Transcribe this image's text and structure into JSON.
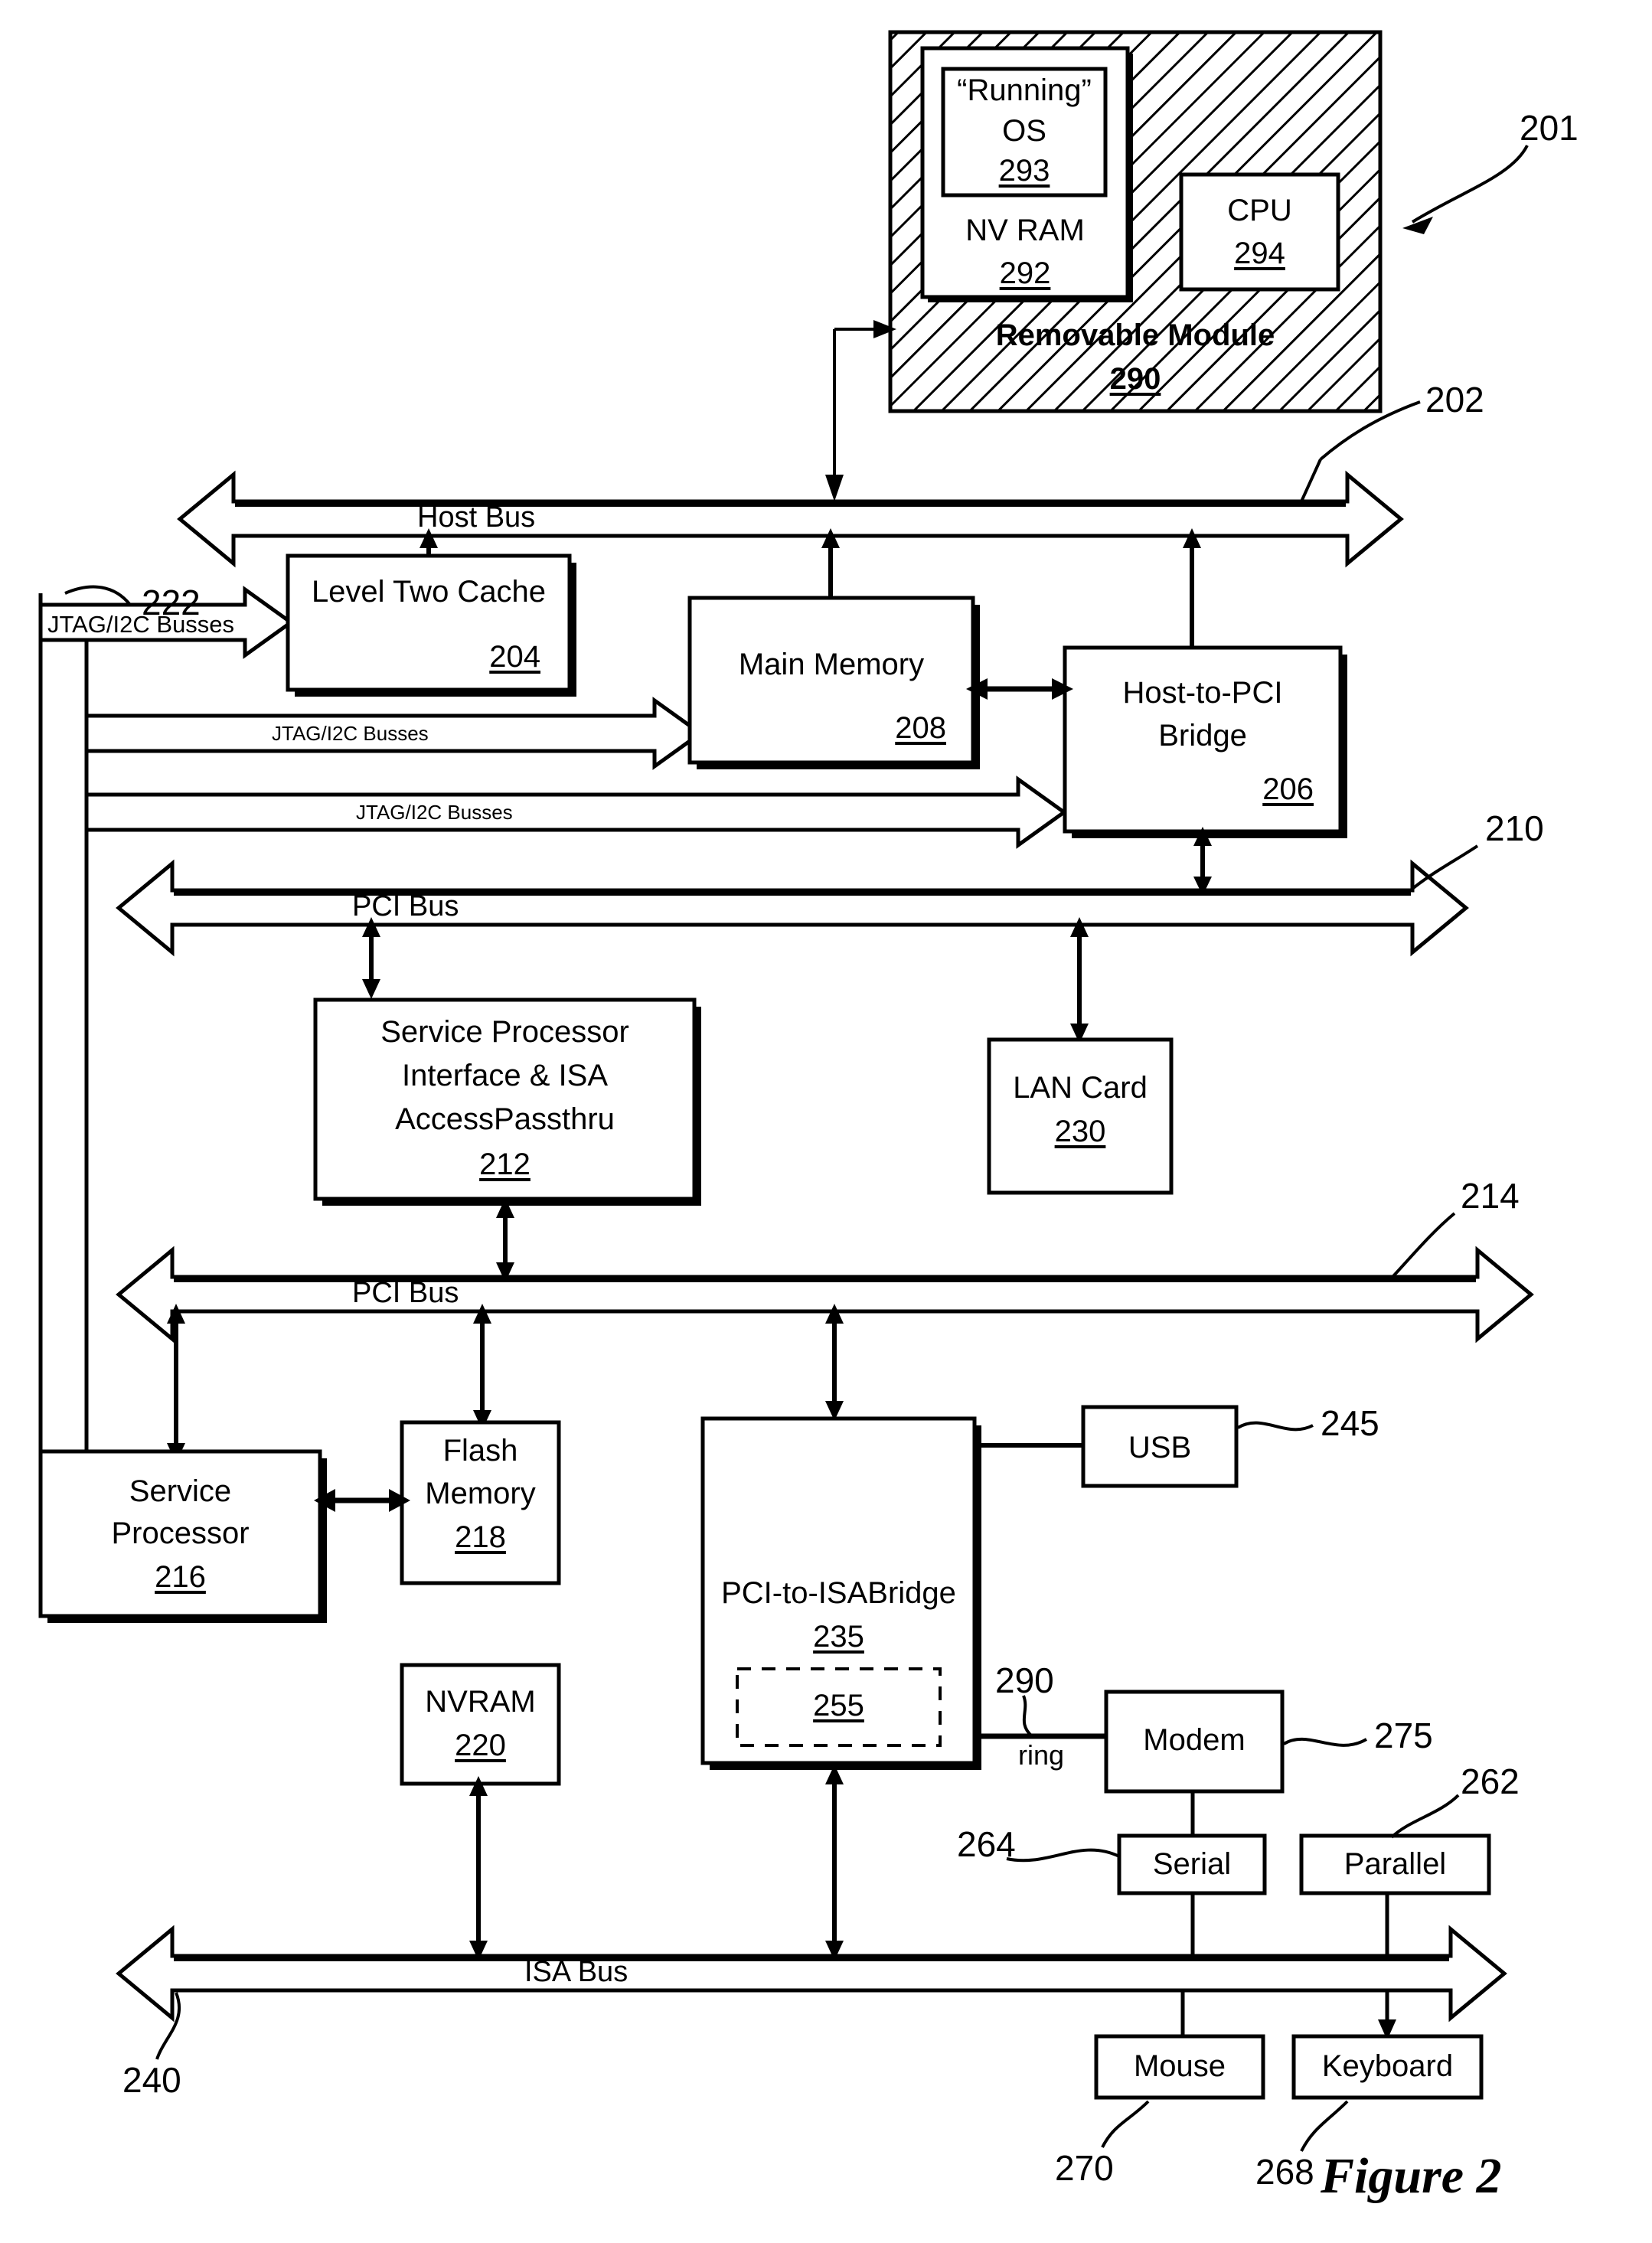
{
  "figure": {
    "caption": "Figure 2"
  },
  "module": {
    "title": "Removable Module",
    "ref": "290",
    "nvram": {
      "title": "NV RAM",
      "ref": "292"
    },
    "os": {
      "line1": "“Running”",
      "line2": "OS",
      "ref": "293"
    },
    "cpu": {
      "title": "CPU",
      "ref": "294"
    }
  },
  "callouts": {
    "system": "201",
    "host_bus": "202",
    "jtag": "222",
    "pci_bus_upper": "210",
    "pci_bus_lower": "214",
    "isa_bus": "240",
    "usb": "245",
    "parallel": "262",
    "serial": "264",
    "keyboard": "268",
    "mouse": "270",
    "modem": "275",
    "ring_line": "290"
  },
  "buses": {
    "host": "Host Bus",
    "pci_upper": "PCI Bus",
    "pci_lower": "PCI Bus",
    "isa": "ISA Bus",
    "jtag_1": "JTAG/I2C Busses",
    "jtag_2": "JTAG/I2C Busses",
    "jtag_3": "JTAG/I2C Busses",
    "ring": "ring"
  },
  "blocks": {
    "l2cache": {
      "title": "Level Two Cache",
      "ref": "204"
    },
    "mainmem": {
      "title": "Main Memory",
      "ref": "208"
    },
    "hostpci": {
      "line1": "Host-to-PCI",
      "line2": "Bridge",
      "ref": "206"
    },
    "spi": {
      "line1": "Service Processor",
      "line2": "Interface & ISA",
      "line3": "AccessPassthru",
      "ref": "212"
    },
    "lancard": {
      "title": "LAN Card",
      "ref": "230"
    },
    "svcproc": {
      "line1": "Service",
      "line2": "Processor",
      "ref": "216"
    },
    "flash": {
      "line1": "Flash",
      "line2": "Memory",
      "ref": "218"
    },
    "nvram220": {
      "title": "NVRAM",
      "ref": "220"
    },
    "pciisa": {
      "title": "PCI-to-ISABridge",
      "ref": "235",
      "inner_ref": "255"
    },
    "usb": {
      "title": "USB"
    },
    "modem": {
      "title": "Modem"
    },
    "serial": {
      "title": "Serial"
    },
    "parallel": {
      "title": "Parallel"
    },
    "mouse": {
      "title": "Mouse"
    },
    "keyboard": {
      "title": "Keyboard"
    }
  },
  "colors": {
    "ink": "#000000",
    "paper": "#ffffff"
  }
}
